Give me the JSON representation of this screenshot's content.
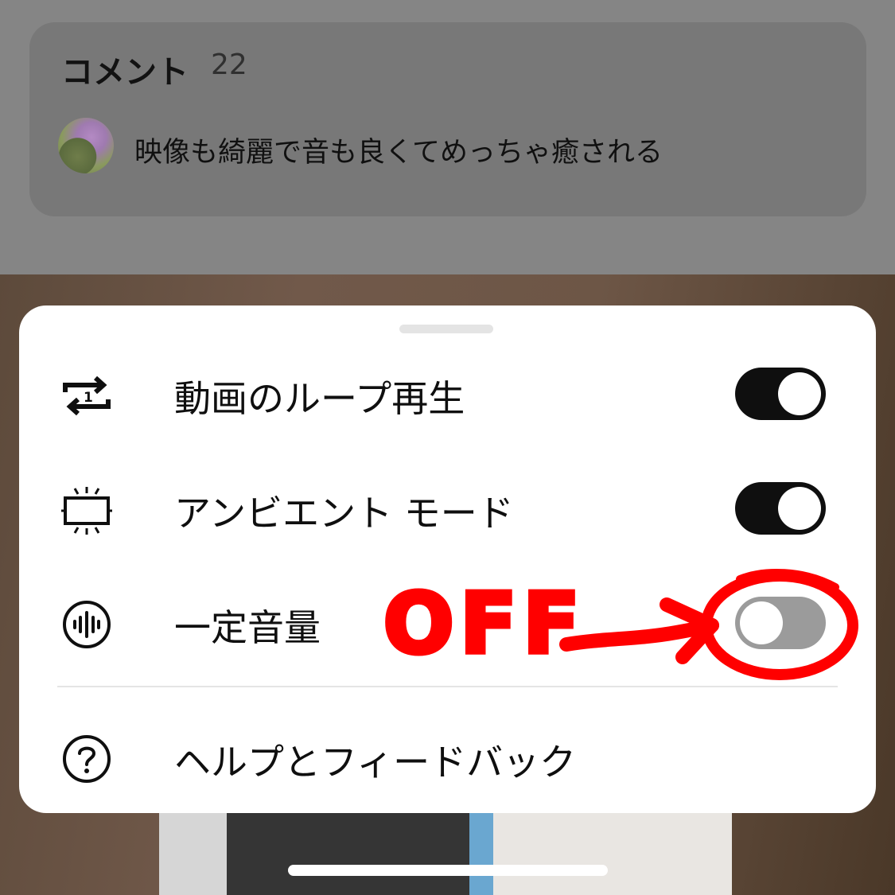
{
  "comments": {
    "title": "コメント",
    "count": "22",
    "top_comment": "映像も綺麗で音も良くてめっちゃ癒される",
    "avatar_icon": "avatar"
  },
  "settings_sheet": {
    "items": [
      {
        "label": "動画のループ再生",
        "icon": "repeat-one-icon",
        "toggle": true
      },
      {
        "label": "アンビエント モード",
        "icon": "ambient-mode-icon",
        "toggle": true
      },
      {
        "label": "一定音量",
        "icon": "stable-volume-icon",
        "toggle": false
      }
    ],
    "help": {
      "label": "ヘルプとフィードバック",
      "icon": "help-icon"
    }
  },
  "annotation": {
    "text": "OFF",
    "color": "#ff0000"
  },
  "colors": {
    "toggle_on": "#0f0f0f",
    "toggle_off": "#9b9b9b",
    "sheet_bg": "#ffffff"
  }
}
